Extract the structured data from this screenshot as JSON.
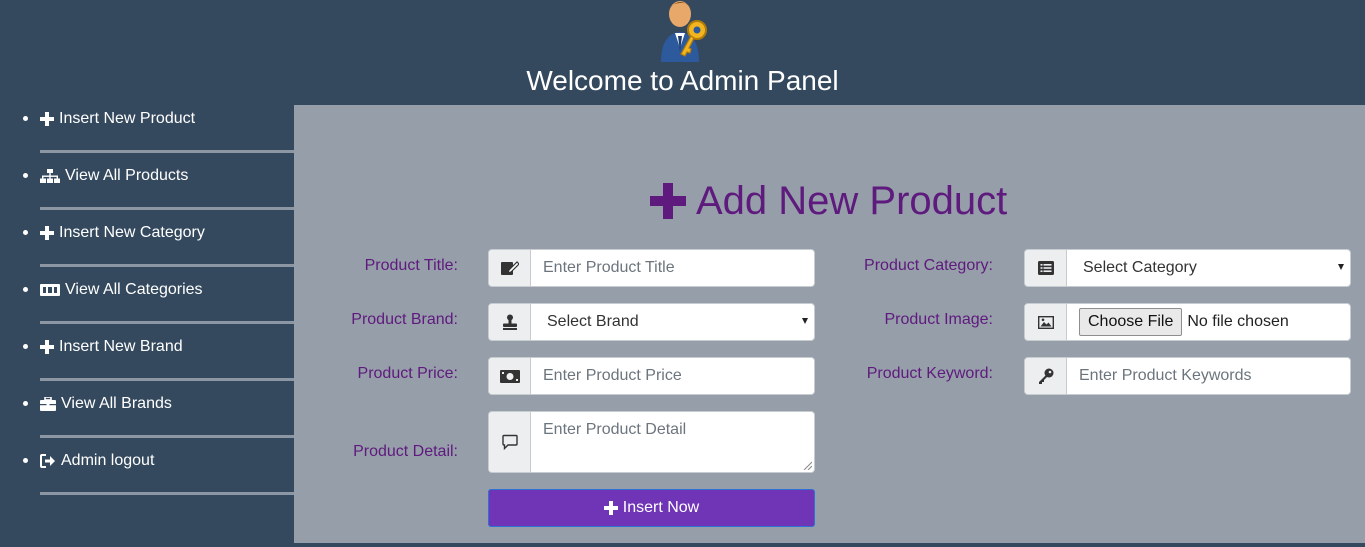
{
  "header": {
    "title": "Welcome to Admin Panel",
    "logo_icon": "admin-user-key-icon"
  },
  "sidebar": {
    "items": [
      {
        "label": "Insert New Product",
        "icon": "plus-icon"
      },
      {
        "label": "View All Products",
        "icon": "sitemap-icon"
      },
      {
        "label": "Insert New Category",
        "icon": "plus-icon"
      },
      {
        "label": "View All Categories",
        "icon": "grid-table-icon"
      },
      {
        "label": "Insert New Brand",
        "icon": "plus-icon"
      },
      {
        "label": "View All Brands",
        "icon": "briefcase-icon"
      },
      {
        "label": "Admin logout",
        "icon": "sign-out-icon"
      }
    ]
  },
  "form": {
    "title": "Add New Product",
    "title_icon": "plus-icon",
    "title_color": "#5f1a7e",
    "product_title": {
      "label": "Product Title:",
      "placeholder": "Enter Product Title",
      "icon": "edit-pen-icon"
    },
    "product_brand": {
      "label": "Product Brand:",
      "value": "Select Brand",
      "icon": "stamp-icon"
    },
    "product_price": {
      "label": "Product Price:",
      "placeholder": "Enter Product Price",
      "icon": "money-bill-icon"
    },
    "product_detail": {
      "label": "Product Detail:",
      "placeholder": "Enter Product Detail",
      "icon": "comment-icon"
    },
    "product_category": {
      "label": "Product Category:",
      "value": "Select Category",
      "icon": "list-icon"
    },
    "product_image": {
      "label": "Product Image:",
      "button": "Choose File",
      "status": "No file chosen",
      "icon": "image-icon"
    },
    "product_keyword": {
      "label": "Product Keyword:",
      "placeholder": "Enter Product Keywords",
      "icon": "key-icon"
    },
    "submit": {
      "label": "Insert Now",
      "icon": "plus-icon",
      "color": "#6f35b6"
    }
  }
}
